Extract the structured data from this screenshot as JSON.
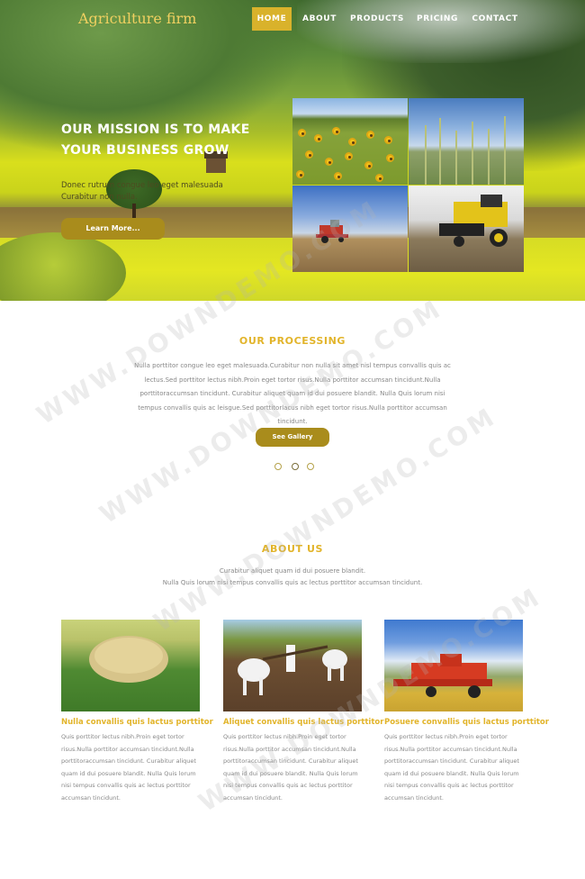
{
  "brand": "Agriculture firm",
  "nav": [
    "HOME",
    "ABOUT",
    "PRODUCTS",
    "PRICING",
    "CONTACT"
  ],
  "nav_active": "HOME",
  "hero": {
    "title": "OUR MISSION IS TO MAKE YOUR BUSINESS GROW",
    "text": "Donec rutrum congue leo eget malesuada Curabitur non nulla.",
    "button": "Learn More..."
  },
  "processing": {
    "title": "OUR PROCESSING",
    "text": "Nulla porttitor congue leo eget malesuada.Curabitur non nulla sit amet nisl tempus convallis quis ac lectus.Sed porttitor lectus nibh.Proin eget tortor risus.Nulla porttitor accumsan tincidunt.Nulla porttitoraccumsan tincidunt. Curabitur aliquet quam id dui posuere blandit. Nulla Quis lorum nisi tempus convallis quis ac leisgue.Sed porttitorlacus nibh eget tortor risus.Nulla porttitor accumsan tincidunt.",
    "button": "See Gallery"
  },
  "about": {
    "title": "ABOUT US",
    "subtitle_line1": "Curabitur aliquet quam id dui posuere blandit.",
    "subtitle_line2": "Nulla Quis lorum nisi tempus convallis quis ac lectus porttitor accumsan tincidunt.",
    "cards": [
      {
        "title": "Nulla convallis quis lactus porttitor",
        "text": "Quis porttitor lectus nibh.Proin eget tortor risus.Nulla porttitor accumsan tincidunt.Nulla porttitoraccumsan tincidunt. Curabitur aliquet quam id dui posuere blandit. Nulla Quis lorum nisi tempus convallis quis ac lectus porttitor accumsan tincidunt."
      },
      {
        "title": "Aliquet convallis quis lactus porttitor",
        "text": "Quis porttitor lectus nibh.Proin eget tortor risus.Nulla porttitor accumsan tincidunt.Nulla porttitoraccumsan tincidunt. Curabitur aliquet quam id dui posuere blandit. Nulla Quis lorum nisi tempus convallis quis ac lectus porttitor accumsan tincidunt."
      },
      {
        "title": "Posuere convallis quis lactus porttitor",
        "text": "Quis porttitor lectus nibh.Proin eget tortor risus.Nulla porttitor accumsan tincidunt.Nulla porttitoraccumsan tincidunt. Curabitur aliquet quam id dui posuere blandit. Nulla Quis lorum nisi tempus convallis quis ac lectus porttitor accumsan tincidunt."
      }
    ]
  },
  "watermark": "WWW.DOWNDEMO.COM",
  "colors": {
    "accent": "#e2b42a",
    "button": "#a98c1c",
    "nav_active": "#d9b22b"
  }
}
